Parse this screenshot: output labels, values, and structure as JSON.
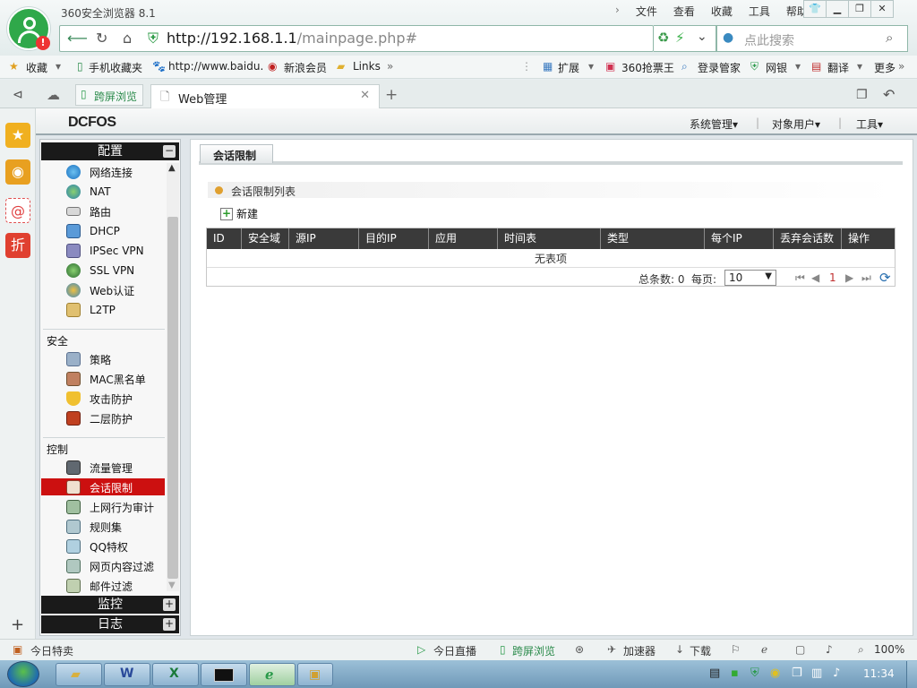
{
  "browser": {
    "title": "360安全浏览器 8.1",
    "menu": [
      "文件",
      "查看",
      "收藏",
      "工具",
      "帮助"
    ],
    "url_host": "http://192.168.1.1",
    "url_path": "/mainpage.php#",
    "search_placeholder": "点此搜索",
    "bookmarks": [
      "收藏",
      "手机收藏夹",
      "http://www.baidu.",
      "新浪会员",
      "Links"
    ],
    "bookmarks_right": [
      "扩展",
      "360抢票王",
      "登录管家",
      "网银",
      "翻译",
      "更多"
    ],
    "tabs": [
      "跨屏浏览",
      "Web管理"
    ]
  },
  "app": {
    "brand": "DCFOS",
    "header_menu": [
      "系统管理",
      "对象用户",
      "工具"
    ]
  },
  "sidebar": {
    "config_title": "配置",
    "config_items": [
      "网络连接",
      "NAT",
      "路由",
      "DHCP",
      "IPSec VPN",
      "SSL VPN",
      "Web认证",
      "L2TP"
    ],
    "security_title": "安全",
    "security_items": [
      "策略",
      "MAC黑名单",
      "攻击防护",
      "二层防护"
    ],
    "control_title": "控制",
    "control_items": [
      "流量管理",
      "会话限制",
      "上网行为审计",
      "规则集",
      "QQ特权",
      "网页内容过滤",
      "邮件过滤"
    ],
    "monitor_title": "监控",
    "log_title": "日志"
  },
  "content": {
    "tab": "会话限制",
    "list_title": "会话限制列表",
    "new_label": "新建",
    "columns": [
      "ID",
      "安全域",
      "源IP",
      "目的IP",
      "应用",
      "时间表",
      "类型",
      "每个IP",
      "丢弃会话数",
      "操作"
    ],
    "empty_text": "无表项",
    "total_label": "总条数: 0",
    "per_page_label": "每页:",
    "per_page_value": "10",
    "page_number": "1"
  },
  "statusbar": {
    "left": "今日特卖",
    "items": [
      "今日直播",
      "跨屏浏览",
      "加速器",
      "下载"
    ],
    "zoom": "100%"
  },
  "taskbar": {
    "clock": "11:34"
  }
}
